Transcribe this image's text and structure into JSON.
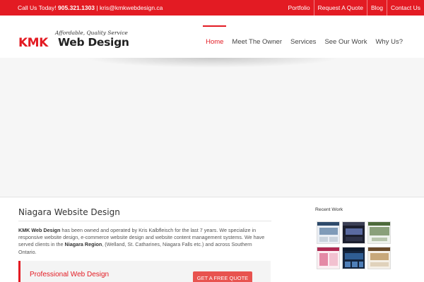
{
  "topbar": {
    "call_label": "Call Us Today!",
    "phone": "905.321.1303",
    "separator": "|",
    "email": "kris@kmkwebdesign.ca",
    "links": [
      "Portfolio",
      "Request A Quote",
      "Blog",
      "Contact Us"
    ]
  },
  "logo": {
    "tagline": "Affordable, Quality Service",
    "kmk": "KMK",
    "web_design": "Web Design"
  },
  "nav": {
    "items": [
      "Home",
      "Meet The Owner",
      "Services",
      "See Our Work",
      "Why Us?"
    ],
    "active": "Home"
  },
  "main": {
    "heading": "Niagara Website Design",
    "intro_bold1": "KMK Web Design",
    "intro_text1": " has been owned and operated by Kris Kalbfleisch for the last 7 years. We specialize in responsive website design, e-commerce website design and website content management systems. We have served clients in the ",
    "intro_bold2": "Niagara Region",
    "intro_text2": ", (Welland, St. Catharines, Niagara Falls etc.) and across Southern Ontario.",
    "cta_title": "Professional Web Design",
    "cta_button": "GET A FREE QUOTE"
  },
  "sidebar": {
    "recent_work_title": "Recent Work",
    "thumbnails": [
      "recent-work-1",
      "recent-work-2",
      "recent-work-3",
      "recent-work-4",
      "recent-work-5",
      "recent-work-6"
    ]
  },
  "colors": {
    "brand_red": "#e31b23",
    "button_red": "#e8534f",
    "slider_bg": "#f6f6f6"
  }
}
